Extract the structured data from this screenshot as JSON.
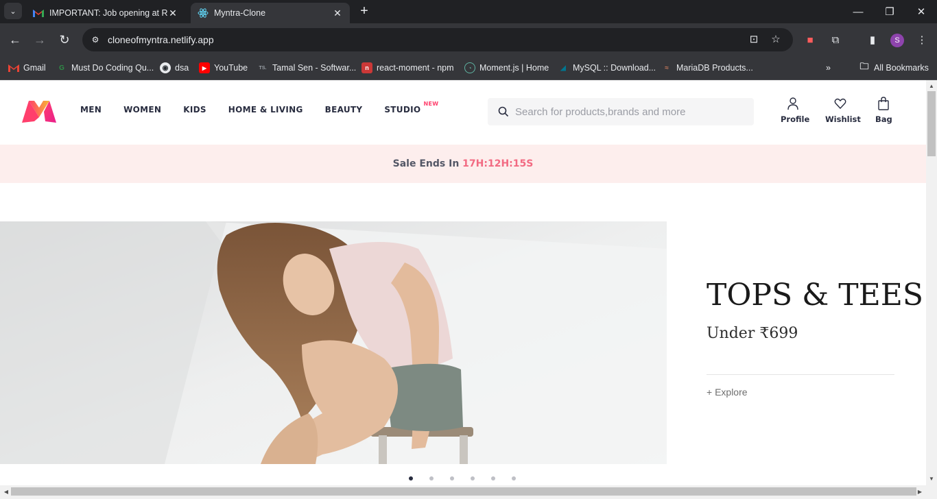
{
  "browser": {
    "tabs": [
      {
        "title": "IMPORTANT: Job opening at Re",
        "favicon": "gmail-icon",
        "active": false
      },
      {
        "title": "Myntra-Clone",
        "favicon": "react-icon",
        "active": true
      }
    ],
    "url": "cloneofmyntra.netlify.app",
    "profile_initial": "S",
    "bookmarks": [
      {
        "label": "Gmail",
        "icon": "gmail-icon"
      },
      {
        "label": "Must Do Coding Qu...",
        "icon": "gfg-icon"
      },
      {
        "label": "dsa",
        "icon": "github-icon"
      },
      {
        "label": "YouTube",
        "icon": "youtube-icon"
      },
      {
        "label": "Tamal Sen - Softwar...",
        "icon": "ts-icon"
      },
      {
        "label": "react-moment - npm",
        "icon": "npm-icon"
      },
      {
        "label": "Moment.js | Home",
        "icon": "moment-icon"
      },
      {
        "label": "MySQL :: Download...",
        "icon": "mysql-icon"
      },
      {
        "label": "MariaDB Products...",
        "icon": "mariadb-icon"
      }
    ],
    "all_bookmarks_label": "All Bookmarks"
  },
  "header": {
    "nav": [
      "MEN",
      "WOMEN",
      "KIDS",
      "HOME & LIVING",
      "BEAUTY",
      "STUDIO"
    ],
    "new_badge": "NEW",
    "search_placeholder": "Search for products,brands and more",
    "actions": {
      "profile": "Profile",
      "wishlist": "Wishlist",
      "bag": "Bag"
    }
  },
  "sale": {
    "label": "Sale Ends In",
    "timer": "17H:12H:15S"
  },
  "banner": {
    "title": "TOPS & TEES",
    "subtitle": "Under ₹699",
    "cta": "+ Explore",
    "slide_count": 6,
    "active_slide": 1
  },
  "colors": {
    "brand_pink": "#ff3f6c",
    "sale_bg": "#fdeeed",
    "timer": "#f26a82",
    "text_dark": "#282c3f"
  }
}
